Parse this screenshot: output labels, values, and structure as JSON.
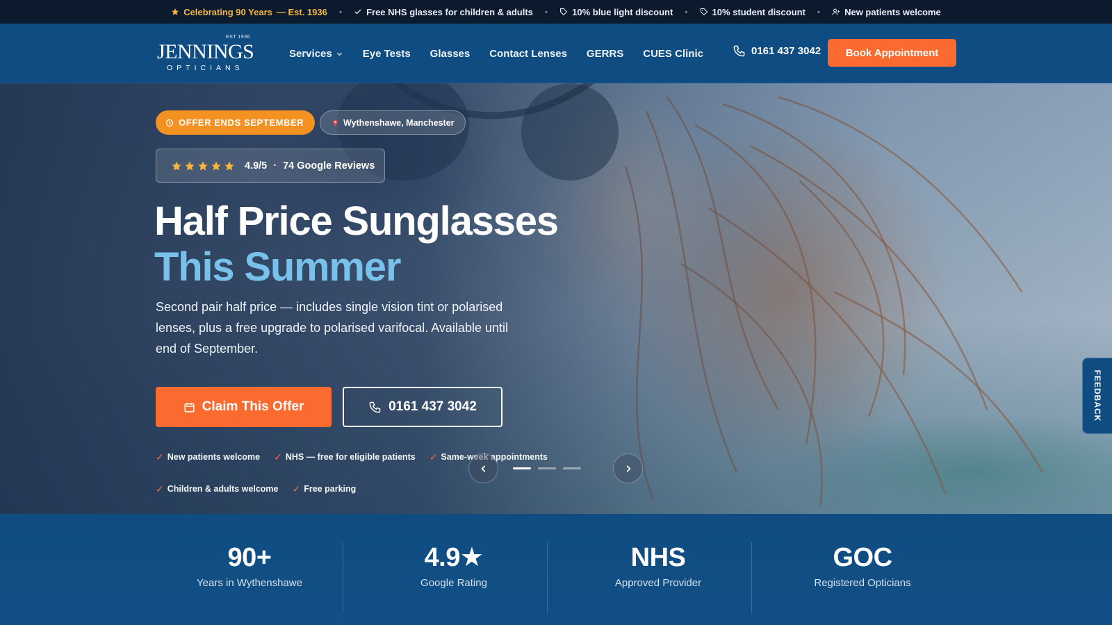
{
  "topbar": {
    "anniversary": "Celebrating 90 Years",
    "est": "— Est. 1936",
    "items": [
      "Free NHS glasses for children & adults",
      "10% blue light discount",
      "10% student discount",
      "New patients welcome"
    ],
    "separator": "•"
  },
  "header": {
    "logo": {
      "est": "EST 1936",
      "name": "JENNINGS",
      "sub": "OPTICIANS"
    },
    "nav": [
      "Services",
      "Eye Tests",
      "Glasses",
      "Contact Lenses",
      "GERRS",
      "CUES Clinic"
    ],
    "phone": "0161 437 3042",
    "book_label": "Book Appointment"
  },
  "hero": {
    "offer_badge": "OFFER ENDS SEPTEMBER",
    "location_badge": "Wythenshawe, Manchester",
    "rating": {
      "stars": 5,
      "score": "4.9/5",
      "dot": "·",
      "reviews": "74 Google Reviews"
    },
    "headline_line1": "Half Price Sunglasses",
    "headline_line2": "This Summer",
    "description": "Second pair half price — includes single vision tint or polarised lenses, plus a free upgrade to polarised varifocal. Available until end of September.",
    "claim_label": "Claim This Offer",
    "phone_label": "0161 437 3042",
    "checks": [
      "New patients welcome",
      "NHS — free for eligible patients",
      "Same-week appointments",
      "Children & adults welcome",
      "Free parking"
    ],
    "tick": "✓",
    "slides": {
      "count": 3,
      "active": 0
    }
  },
  "feedback_label": "FEEDBACK",
  "stats": [
    {
      "value": "90+",
      "label": "Years in Wythenshawe"
    },
    {
      "value": "4.9★",
      "label": "Google Rating"
    },
    {
      "value": "NHS",
      "label": "Approved Provider"
    },
    {
      "value": "GOC",
      "label": "Registered Opticians"
    }
  ],
  "colors": {
    "brand_blue": "#0f4c81",
    "accent_orange": "#fb6a2f",
    "offer_orange": "#f39220",
    "headline_blue": "#78c1ea",
    "star_gold": "#f6b73c",
    "topbar": "#0b1a2c"
  }
}
